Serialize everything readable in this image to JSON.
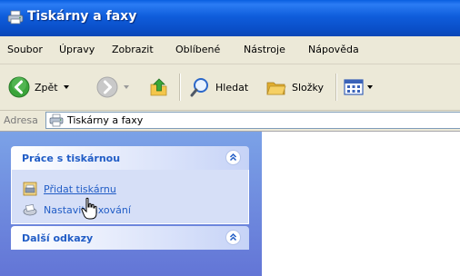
{
  "window": {
    "title": "Tiskárny a faxy",
    "icon": "printers-faxes-icon"
  },
  "menu": [
    {
      "label": "Soubor"
    },
    {
      "label": "Úpravy"
    },
    {
      "label": "Zobrazit"
    },
    {
      "label": "Oblíbené"
    },
    {
      "label": "Nástroje"
    },
    {
      "label": "Nápověda"
    }
  ],
  "toolbar": {
    "back_label": "Zpět",
    "search_label": "Hledat",
    "folders_label": "Složky",
    "colors": {
      "back_green": "#3aa43a",
      "search_blue": "#2b67c9",
      "folder_yellow": "#f3c64b"
    }
  },
  "address": {
    "label": "Adresa",
    "value": "Tiskárny a faxy"
  },
  "taskpane": {
    "printer_tasks": {
      "title": "Práce s tiskárnou",
      "items": [
        {
          "label": "Přidat tiskárnu",
          "icon": "add-printer-icon",
          "hovered": true
        },
        {
          "label": "Nastavit faxování",
          "icon": "fax-setup-icon",
          "hovered": false
        }
      ]
    },
    "other_links": {
      "title": "Další odkazy"
    }
  }
}
